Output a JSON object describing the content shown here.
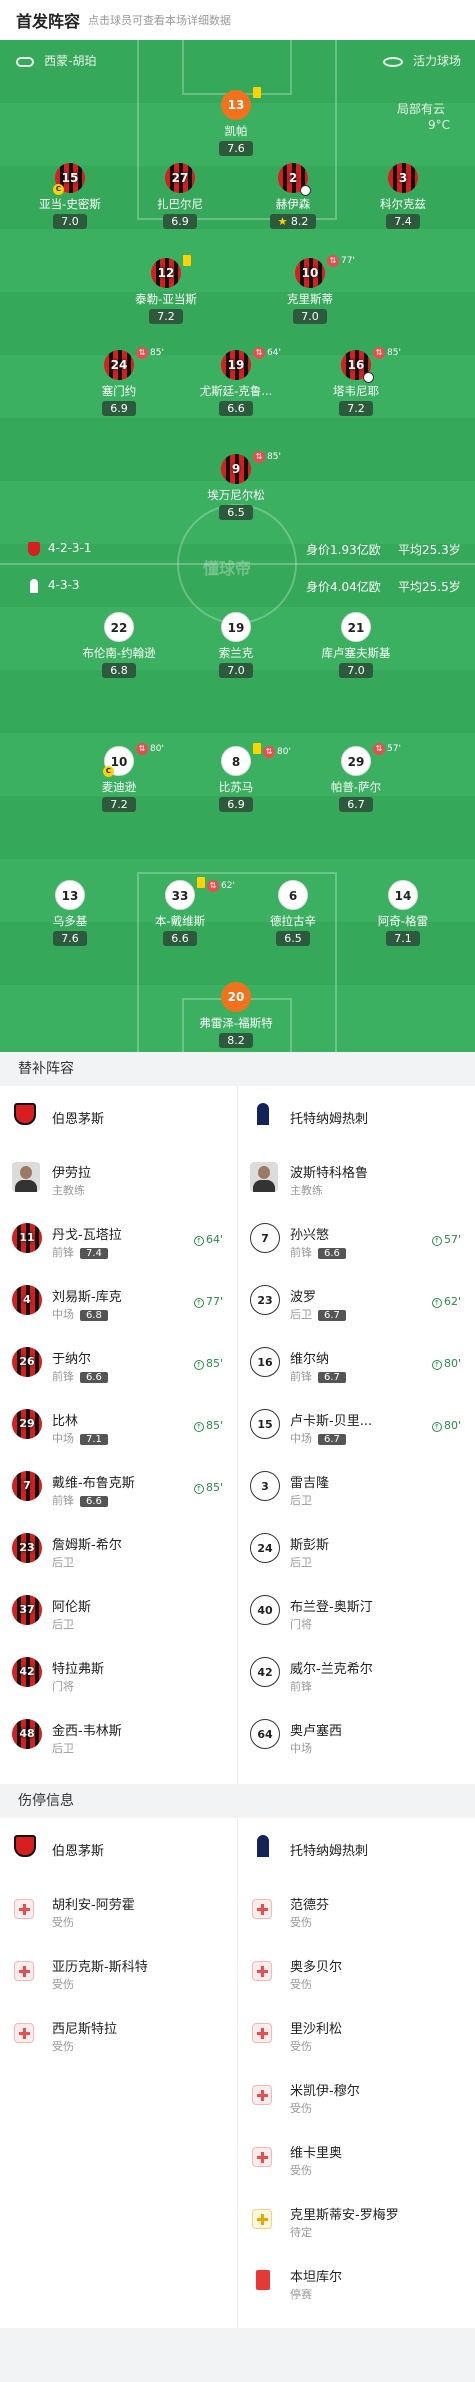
{
  "header": {
    "title": "首发阵容",
    "subtitle": "点击球员可查看本场详细数据"
  },
  "pitch_info": {
    "referee": "西蒙-胡珀",
    "stadium": "活力球场",
    "weather": "局部有云",
    "temperature": "9°C",
    "watermark": "懂球帝"
  },
  "home": {
    "name": "伯恩茅斯",
    "formation": "4-2-3-1",
    "value_text": "身价1.93亿欧",
    "age_text": "平均25.3岁"
  },
  "away": {
    "name": "托特纳姆热刺",
    "formation": "4-3-3",
    "value_text": "身价4.04亿欧",
    "age_text": "平均25.5岁"
  },
  "home_players": [
    {
      "num": "13",
      "name": "凯帕",
      "rating": "7.6",
      "yellow": true
    },
    {
      "num": "15",
      "name": "亚当-史密斯",
      "rating": "7.0",
      "captain": true
    },
    {
      "num": "27",
      "name": "扎巴尔尼",
      "rating": "6.9"
    },
    {
      "num": "2",
      "name": "赫伊森",
      "rating": "8.2",
      "star": true,
      "goal": true
    },
    {
      "num": "3",
      "name": "科尔克兹",
      "rating": "7.4"
    },
    {
      "num": "12",
      "name": "泰勒-亚当斯",
      "rating": "7.2",
      "yellow": true
    },
    {
      "num": "10",
      "name": "克里斯蒂",
      "rating": "7.0",
      "sub": "77'"
    },
    {
      "num": "24",
      "name": "塞门约",
      "rating": "6.9",
      "sub": "85'"
    },
    {
      "num": "19",
      "name": "尤斯廷-克鲁...",
      "rating": "6.6",
      "sub": "64'"
    },
    {
      "num": "16",
      "name": "塔韦尼耶",
      "rating": "7.2",
      "sub": "85'",
      "goal": true
    },
    {
      "num": "9",
      "name": "埃万尼尔松",
      "rating": "6.5",
      "sub": "85'"
    }
  ],
  "away_players": [
    {
      "num": "22",
      "name": "布伦南-约翰逊",
      "rating": "6.8"
    },
    {
      "num": "19",
      "name": "索兰克",
      "rating": "7.0"
    },
    {
      "num": "21",
      "name": "库卢塞夫斯基",
      "rating": "7.0"
    },
    {
      "num": "10",
      "name": "麦迪逊",
      "rating": "7.2",
      "sub": "80'",
      "captain": true
    },
    {
      "num": "8",
      "name": "比苏马",
      "rating": "6.9",
      "sub": "80'",
      "yellow": true
    },
    {
      "num": "29",
      "name": "帕普-萨尔",
      "rating": "6.7",
      "sub": "57'"
    },
    {
      "num": "13",
      "name": "乌多基",
      "rating": "7.6"
    },
    {
      "num": "33",
      "name": "本-戴维斯",
      "rating": "6.6",
      "sub": "62'",
      "yellow": true
    },
    {
      "num": "6",
      "name": "德拉古辛",
      "rating": "6.5"
    },
    {
      "num": "14",
      "name": "阿奇-格雷",
      "rating": "7.1"
    },
    {
      "num": "20",
      "name": "弗雷泽-福斯特",
      "rating": "8.2"
    }
  ],
  "subs_title": "替补阵容",
  "coach_label": "主教练",
  "home_coach": "伊劳拉",
  "away_coach": "波斯特科格鲁",
  "home_subs": [
    {
      "num": "11",
      "name": "丹戈-瓦塔拉",
      "pos": "前锋",
      "rating": "7.4",
      "min": "64'"
    },
    {
      "num": "4",
      "name": "刘易斯-库克",
      "pos": "中场",
      "rating": "6.8",
      "min": "77'"
    },
    {
      "num": "26",
      "name": "于纳尔",
      "pos": "前锋",
      "rating": "6.6",
      "min": "85'"
    },
    {
      "num": "29",
      "name": "比林",
      "pos": "中场",
      "rating": "7.1",
      "min": "85'"
    },
    {
      "num": "7",
      "name": "戴维-布鲁克斯",
      "pos": "前锋",
      "rating": "6.6",
      "min": "85'"
    },
    {
      "num": "23",
      "name": "詹姆斯-希尔",
      "pos": "后卫"
    },
    {
      "num": "37",
      "name": "阿伦斯",
      "pos": "后卫"
    },
    {
      "num": "42",
      "name": "特拉弗斯",
      "pos": "门将"
    },
    {
      "num": "48",
      "name": "金西-韦林斯",
      "pos": "后卫"
    }
  ],
  "away_subs": [
    {
      "num": "7",
      "name": "孙兴慜",
      "pos": "前锋",
      "rating": "6.6",
      "min": "57'"
    },
    {
      "num": "23",
      "name": "波罗",
      "pos": "后卫",
      "rating": "6.7",
      "min": "62'"
    },
    {
      "num": "16",
      "name": "维尔纳",
      "pos": "前锋",
      "rating": "6.7",
      "min": "80'"
    },
    {
      "num": "15",
      "name": "卢卡斯-贝里...",
      "pos": "中场",
      "rating": "6.7",
      "min": "80'"
    },
    {
      "num": "3",
      "name": "雷吉隆",
      "pos": "后卫"
    },
    {
      "num": "24",
      "name": "斯彭斯",
      "pos": "后卫"
    },
    {
      "num": "40",
      "name": "布兰登-奥斯汀",
      "pos": "门将"
    },
    {
      "num": "42",
      "name": "威尔-兰克希尔",
      "pos": "前锋"
    },
    {
      "num": "64",
      "name": "奥卢塞西",
      "pos": "中场"
    }
  ],
  "injury_title": "伤停信息",
  "home_injuries": [
    {
      "name": "胡利安-阿劳霍",
      "status": "受伤"
    },
    {
      "name": "亚历克斯-斯科特",
      "status": "受伤"
    },
    {
      "name": "西尼斯特拉",
      "status": "受伤"
    }
  ],
  "away_injuries": [
    {
      "name": "范德芬",
      "status": "受伤"
    },
    {
      "name": "奥多贝尔",
      "status": "受伤"
    },
    {
      "name": "里沙利松",
      "status": "受伤"
    },
    {
      "name": "米凯伊-穆尔",
      "status": "受伤"
    },
    {
      "name": "维卡里奥",
      "status": "受伤"
    },
    {
      "name": "克里斯蒂安-罗梅罗",
      "status": "待定"
    },
    {
      "name": "本坦库尔",
      "status": "停赛"
    }
  ]
}
